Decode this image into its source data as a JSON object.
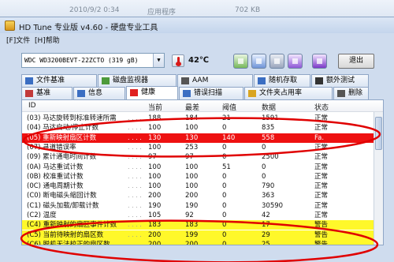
{
  "background_strip": {
    "date": "2010/9/2 0:34",
    "type": "应用程序",
    "size": "702 KB"
  },
  "window": {
    "title": "HD Tune 专业版 v4.60 - 硬盘专业工具"
  },
  "menu": [
    {
      "label": "[F]文件"
    },
    {
      "label": "[H]帮助"
    }
  ],
  "toolbar": {
    "drive": "WDC WD3200BEVT-22ZCTO (319 gB)",
    "temperature": "42℃",
    "exit_label": "退出"
  },
  "tabs_row1": [
    {
      "label": "文件基准",
      "icon": "document-icon",
      "color": "#3b6ec2"
    },
    {
      "label": "磁盘监视器",
      "icon": "monitor-icon",
      "color": "#4d9a3a"
    },
    {
      "label": "AAM",
      "icon": "speaker-icon",
      "color": "#555555"
    },
    {
      "label": "随机存取",
      "icon": "random-access-icon",
      "color": "#3b6ec2"
    },
    {
      "label": "额外测试",
      "icon": "extra-tests-icon",
      "color": "#333333"
    }
  ],
  "tabs_row2": [
    {
      "label": "基准",
      "icon": "benchmark-icon",
      "color": "#c23a3a"
    },
    {
      "label": "信息",
      "icon": "info-icon",
      "color": "#3b6ec2"
    },
    {
      "label": "健康",
      "icon": "health-cross-icon",
      "color": "#e02020"
    },
    {
      "label": "错误扫描",
      "icon": "error-scan-icon",
      "color": "#3b6ec2"
    },
    {
      "label": "文件夹占用率",
      "icon": "folder-icon",
      "color": "#d9a521"
    },
    {
      "label": "删除",
      "icon": "delete-icon",
      "color": "#555555"
    }
  ],
  "table": {
    "columns": [
      "ID",
      "当前",
      "最差",
      "阈值",
      "数据",
      "状态"
    ],
    "rows": [
      {
        "id": "(03) 马达旋转到标准转速所需",
        "current": "188",
        "worst": "184",
        "threshold": "21",
        "data": "1591",
        "status": "正常",
        "highlight": ""
      },
      {
        "id": "(04) 马达启动/停止计数",
        "current": "100",
        "worst": "100",
        "threshold": "0",
        "data": "835",
        "status": "正常",
        "highlight": ""
      },
      {
        "id": "(05) 重新映射扇区计数",
        "current": "130",
        "worst": "130",
        "threshold": "140",
        "data": "558",
        "status": "Fa.",
        "highlight": "red"
      },
      {
        "id": "(07) 寻道错误率",
        "current": "100",
        "worst": "253",
        "threshold": "0",
        "data": "0",
        "status": "正常",
        "highlight": ""
      },
      {
        "id": "(09) 累计通电时间计数",
        "current": "97",
        "worst": "97",
        "threshold": "0",
        "data": "2500",
        "status": "正常",
        "highlight": ""
      },
      {
        "id": "(0A) 马达重试计数",
        "current": "100",
        "worst": "100",
        "threshold": "51",
        "data": "0",
        "status": "正常",
        "highlight": ""
      },
      {
        "id": "(0B) 校准重试计数",
        "current": "100",
        "worst": "100",
        "threshold": "0",
        "data": "0",
        "status": "正常",
        "highlight": ""
      },
      {
        "id": "(0C) 通电周期计数",
        "current": "100",
        "worst": "100",
        "threshold": "0",
        "data": "790",
        "status": "正常",
        "highlight": ""
      },
      {
        "id": "(C0) 断电磁头缩回计数",
        "current": "200",
        "worst": "200",
        "threshold": "0",
        "data": "363",
        "status": "正常",
        "highlight": ""
      },
      {
        "id": "(C1) 磁头加载/卸载计数",
        "current": "190",
        "worst": "190",
        "threshold": "0",
        "data": "30590",
        "status": "正常",
        "highlight": ""
      },
      {
        "id": "(C2) 温度",
        "current": "105",
        "worst": "92",
        "threshold": "0",
        "data": "42",
        "status": "正常",
        "highlight": ""
      },
      {
        "id": "(C4) 重新映射的扇区事件计数",
        "current": "183",
        "worst": "183",
        "threshold": "0",
        "data": "17",
        "status": "警告",
        "highlight": "yellow"
      },
      {
        "id": "(C5) 当前待映射的扇区数",
        "current": "200",
        "worst": "199",
        "threshold": "0",
        "data": "29",
        "status": "警告",
        "highlight": "yellow"
      },
      {
        "id": "(C6) 脱机无法校正的扇区数",
        "current": "200",
        "worst": "200",
        "threshold": "0",
        "data": "25",
        "status": "警告",
        "highlight": "yellow"
      }
    ]
  },
  "colors": {
    "warning_row": "#fff82a",
    "failure_row": "#ee1111",
    "annotation_ring": "#e00000"
  }
}
